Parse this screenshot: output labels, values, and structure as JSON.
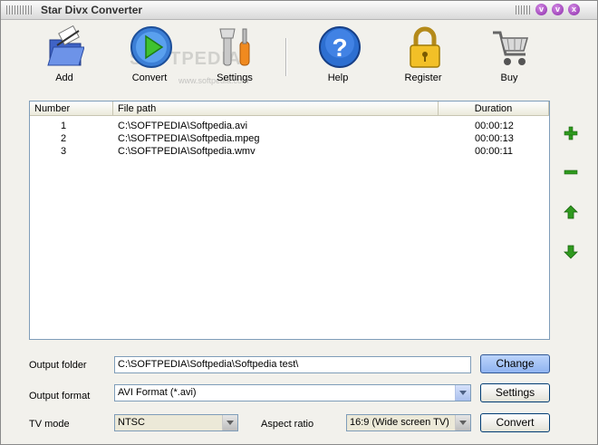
{
  "window": {
    "title": "Star Divx Converter"
  },
  "watermark": {
    "main": "SOFTPEDIA",
    "sub": "www.softpedia.com"
  },
  "toolbar": {
    "items": [
      {
        "label": "Add",
        "icon": "add-folder-icon"
      },
      {
        "label": "Convert",
        "icon": "play-circle-icon"
      },
      {
        "label": "Settings",
        "icon": "tools-icon"
      },
      {
        "label": "Help",
        "icon": "question-icon"
      },
      {
        "label": "Register",
        "icon": "lock-icon"
      },
      {
        "label": "Buy",
        "icon": "cart-icon"
      }
    ]
  },
  "file_list": {
    "columns": [
      "Number",
      "File path",
      "Duration"
    ],
    "rows": [
      {
        "number": "1",
        "path": "C:\\SOFTPEDIA\\Softpedia.avi",
        "duration": "00:00:12"
      },
      {
        "number": "2",
        "path": "C:\\SOFTPEDIA\\Softpedia.mpeg",
        "duration": "00:00:13"
      },
      {
        "number": "3",
        "path": "C:\\SOFTPEDIA\\Softpedia.wmv",
        "duration": "00:00:11"
      }
    ]
  },
  "side_buttons": [
    "plus-icon",
    "minus-icon",
    "arrow-up-icon",
    "arrow-down-icon"
  ],
  "output": {
    "folder_label": "Output folder",
    "folder_value": "C:\\SOFTPEDIA\\Softpedia\\Softpedia test\\",
    "change_label": "Change",
    "format_label": "Output format",
    "format_value": "AVI Format (*.avi)",
    "settings_label": "Settings",
    "tv_label": "TV mode",
    "tv_value": "NTSC",
    "aspect_label": "Aspect ratio",
    "aspect_value": "16:9  (Wide screen TV)",
    "convert_label": "Convert"
  },
  "colors": {
    "accent_green": "#2f9a1e",
    "button_blue": "#8fb3f0",
    "purple_controls": "#8a2aa8"
  }
}
